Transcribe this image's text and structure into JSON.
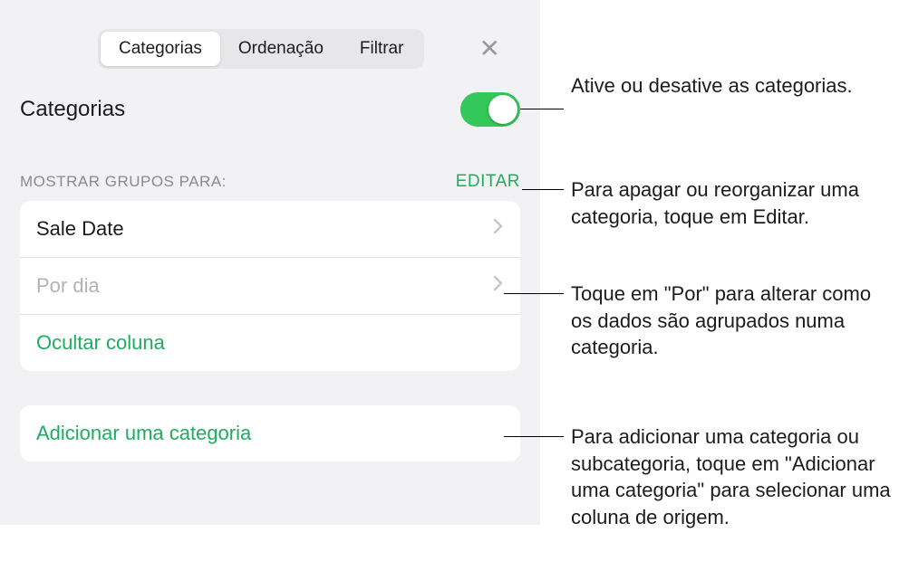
{
  "tabs": {
    "categories": "Categorias",
    "sort": "Ordenação",
    "filter": "Filtrar"
  },
  "header": {
    "title": "Categorias"
  },
  "section": {
    "label": "MOSTRAR GRUPOS PARA:",
    "edit": "EDITAR"
  },
  "rows": {
    "sale_date": "Sale Date",
    "by_day": "Por dia",
    "hide_column": "Ocultar coluna",
    "add_category": "Adicionar uma categoria"
  },
  "annotations": {
    "toggle": "Ative ou desative as categorias.",
    "edit": "Para apagar ou reorganizar uma categoria, toque em Editar.",
    "by": "Toque em \"Por\" para alterar como os dados são agrupados numa categoria.",
    "add": "Para adicionar uma categoria ou subcategoria, toque em \"Adicionar uma categoria\" para selecionar uma coluna de origem."
  }
}
